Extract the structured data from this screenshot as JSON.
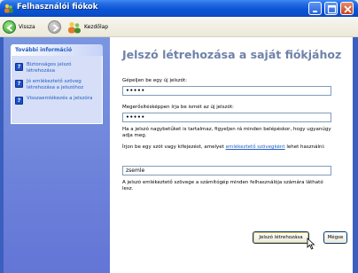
{
  "window": {
    "title": "Felhasználói fiókok",
    "colors": {
      "titlebar": "#0a55d8",
      "sidebar": "#6375d6",
      "accent": "#215dc6",
      "title_text": "#6f82a8"
    }
  },
  "toolbar": {
    "back_label": "Vissza",
    "home_label": "Kezdőlap"
  },
  "sidebar": {
    "header": "További információ",
    "items": [
      {
        "icon": "help-icon",
        "label": "Biztonságos jelszó létrehozása"
      },
      {
        "icon": "help-icon",
        "label": "Jó emlékeztető szöveg létrehozása a jelszóhoz"
      },
      {
        "icon": "help-icon",
        "label": "Visszaemlékezés a jelszóra"
      }
    ]
  },
  "main": {
    "title": "Jelszó létrehozása a saját fiókjához",
    "password_label": "Gépeljen be egy új jelszót:",
    "password_value": "•••••",
    "confirm_label": "Megerősítésképpen írja be ismét az új jelszót:",
    "confirm_value": "•••••",
    "case_note": "Ha a jelszó nagybetűket is tartalmaz, figyeljen rá minden belépéskor, hogy ugyanúgy adja meg.",
    "hint_prompt_before": "Írjon be egy szót vagy kifejezést, amelyet ",
    "hint_prompt_link": "emlékeztető szövegként",
    "hint_prompt_after": " lehet használni:",
    "hint_value": "zsemle",
    "visibility_note": "A jelszó emlékeztető szövege a számítógép minden felhasználója számára látható lesz.",
    "create_button": "Jelszó létrehozása",
    "cancel_button": "Mégse"
  }
}
